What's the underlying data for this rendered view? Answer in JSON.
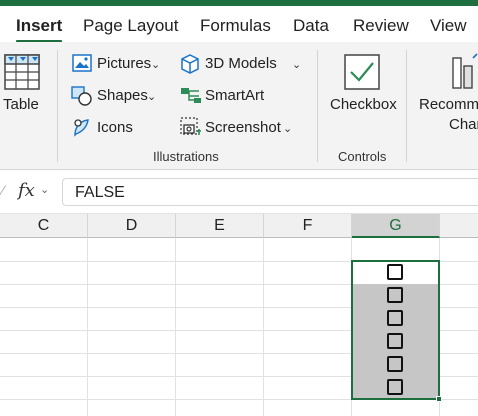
{
  "tabs": [
    "Insert",
    "Page Layout",
    "Formulas",
    "Data",
    "Review",
    "View"
  ],
  "ribbon": {
    "table_label": "Table",
    "illustrations": {
      "pictures": "Pictures",
      "shapes": "Shapes",
      "icons": "Icons",
      "models3d": "3D Models",
      "smartart": "SmartArt",
      "screenshot": "Screenshot",
      "group_label": "Illustrations"
    },
    "controls": {
      "checkbox": "Checkbox",
      "group_label": "Controls"
    },
    "charts": {
      "recommended_line1": "Recomm",
      "recommended_line2": "Char"
    }
  },
  "formula_bar": {
    "fx_label": "fx",
    "value": "FALSE"
  },
  "sheet": {
    "columns": [
      "C",
      "D",
      "E",
      "F",
      "G"
    ],
    "selected_column": "G",
    "checkbox_cells": 6,
    "accent_color": "#1e6f3f",
    "selection_fill": "#c6c6c6"
  }
}
